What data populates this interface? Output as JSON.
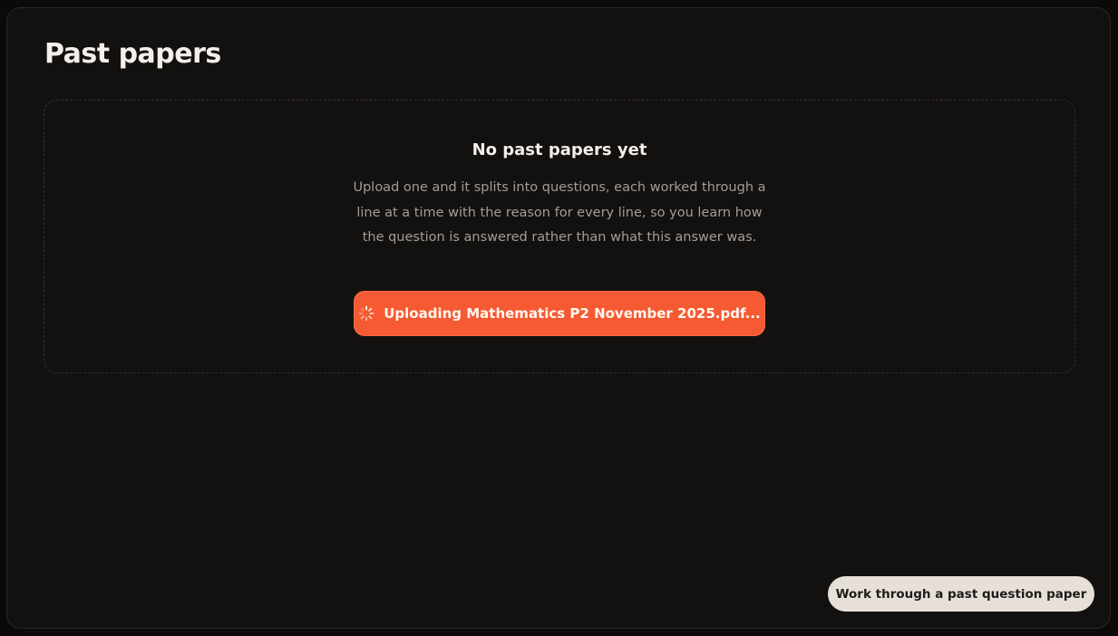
{
  "page": {
    "title": "Past papers"
  },
  "empty_state": {
    "title": "No past papers yet",
    "description": "Upload one and it splits into questions, each worked through a line at a time with the reason for every line, so you learn how the question is answered rather than what this answer was."
  },
  "upload": {
    "label": "Uploading Mathematics P2 November 2025.pdf...",
    "icon": "spinner-icon",
    "status": "uploading"
  },
  "helper": {
    "label": "Work through a past question paper"
  },
  "colors": {
    "background": "#131110",
    "accent": "#f55a32",
    "text_primary": "#f4efe8",
    "text_muted": "#a39d97",
    "pill_background": "#e6e0d9"
  }
}
